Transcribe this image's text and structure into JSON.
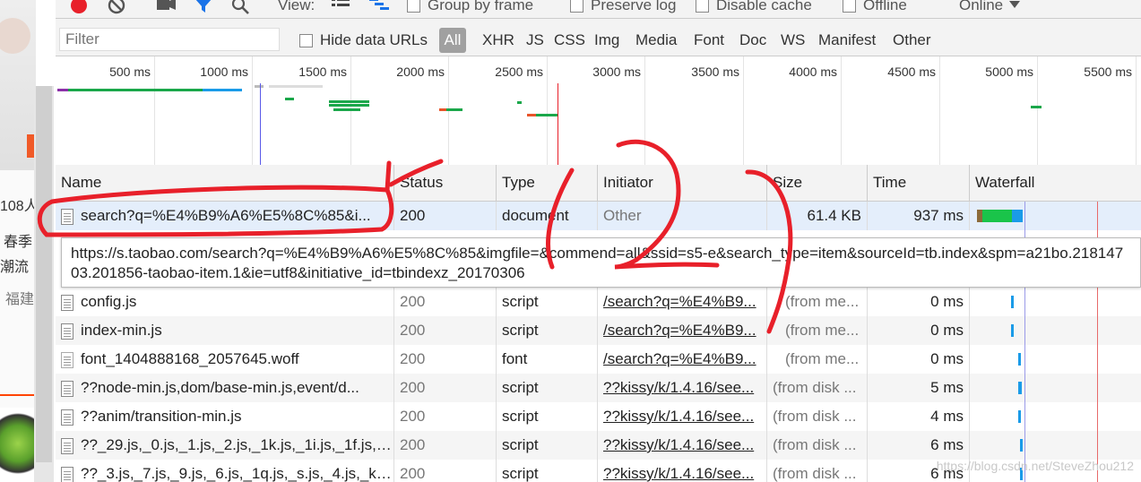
{
  "toolbar": {
    "view_label": "View:",
    "group_by_frame": "Group by frame",
    "preserve_log": "Preserve log",
    "disable_cache": "Disable cache",
    "offline": "Offline",
    "online": "Online"
  },
  "filterbar": {
    "filter_placeholder": "Filter",
    "hide_data_urls": "Hide data URLs",
    "types": [
      "All",
      "XHR",
      "JS",
      "CSS",
      "Img",
      "Media",
      "Font",
      "Doc",
      "WS",
      "Manifest",
      "Other"
    ]
  },
  "overview": {
    "ticks": [
      "500 ms",
      "1000 ms",
      "1500 ms",
      "2000 ms",
      "2500 ms",
      "3000 ms",
      "3500 ms",
      "4000 ms",
      "4500 ms",
      "5000 ms",
      "5500 ms"
    ]
  },
  "columns": [
    "Name",
    "Status",
    "Type",
    "Initiator",
    "Size",
    "Time",
    "Waterfall"
  ],
  "rows": [
    {
      "name": "search?q=%E4%B9%A6%E5%8C%85&i...",
      "status": "200",
      "type": "document",
      "initiator": "Other",
      "size": "61.4 KB",
      "time": "937 ms"
    },
    {
      "name": "config.js",
      "status": "200",
      "type": "script",
      "initiator": "/search?q=%E4%B9...",
      "size": "(from me...",
      "time": "0 ms"
    },
    {
      "name": "index-min.js",
      "status": "200",
      "type": "script",
      "initiator": "/search?q=%E4%B9...",
      "size": "(from me...",
      "time": "0 ms"
    },
    {
      "name": "font_1404888168_2057645.woff",
      "status": "200",
      "type": "font",
      "initiator": "/search?q=%E4%B9...",
      "size": "(from me...",
      "time": "0 ms"
    },
    {
      "name": "??node-min.js,dom/base-min.js,event/d...",
      "status": "200",
      "type": "script",
      "initiator": "??kissy/k/1.4.16/see...",
      "size": "(from disk ...",
      "time": "5 ms"
    },
    {
      "name": "??anim/transition-min.js",
      "status": "200",
      "type": "script",
      "initiator": "??kissy/k/1.4.16/see...",
      "size": "(from disk ...",
      "time": "4 ms"
    },
    {
      "name": "??_29.js,_0.js,_1.js,_2.js,_1k.js,_1i.js,_1f.js,_1...",
      "status": "200",
      "type": "script",
      "initiator": "??kissy/k/1.4.16/see...",
      "size": "(from disk ...",
      "time": "6 ms"
    },
    {
      "name": "??_3.js,_7.js,_9.js,_6.js,_1q.js,_s.js,_4.js,_k.js,...",
      "status": "200",
      "type": "script",
      "initiator": "??kissy/k/1.4.16/see...",
      "size": "(from disk ...",
      "time": "6 ms"
    }
  ],
  "tooltip": "https://s.taobao.com/search?q=%E4%B9%A6%E5%8C%85&imgfile=&commend=all&ssid=s5-e&search_type=item&sourceId=tb.index&spm=a21bo.21814703.201856-taobao-item.1&ie=utf8&initiative_id=tbindexz_20170306",
  "left_page": {
    "price": "108人",
    "line1": "春季",
    "line2": "潮流",
    "line3": "福建"
  },
  "watermark": "https://blog.csdn.net/SteveZhou212",
  "colors": {
    "accent_red": "#e8202a",
    "bar_green": "#1aa74a",
    "bar_blue": "#1a9be8"
  }
}
